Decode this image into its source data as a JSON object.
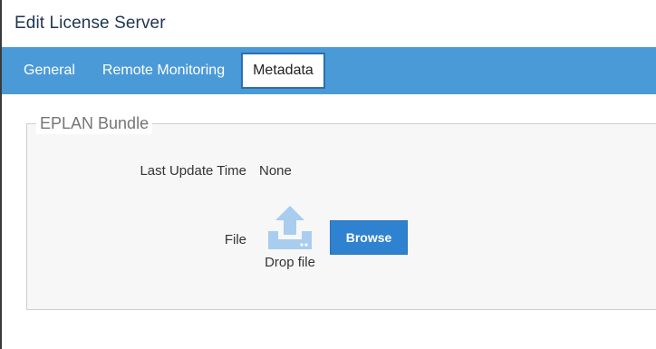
{
  "window": {
    "title": "Edit License Server"
  },
  "tabs": [
    {
      "label": "General",
      "active": false
    },
    {
      "label": "Remote Monitoring",
      "active": false
    },
    {
      "label": "Metadata",
      "active": true
    }
  ],
  "section": {
    "legend": "EPLAN Bundle",
    "last_update": {
      "label": "Last Update Time",
      "value": "None"
    },
    "file": {
      "label": "File",
      "drop_text": "Drop file",
      "browse_label": "Browse",
      "icon": "upload-icon"
    }
  },
  "colors": {
    "tab_bar": "#4b9ad8",
    "button": "#2f82cf",
    "upload_icon": "#a9cdee",
    "title_text": "#1f3550"
  }
}
